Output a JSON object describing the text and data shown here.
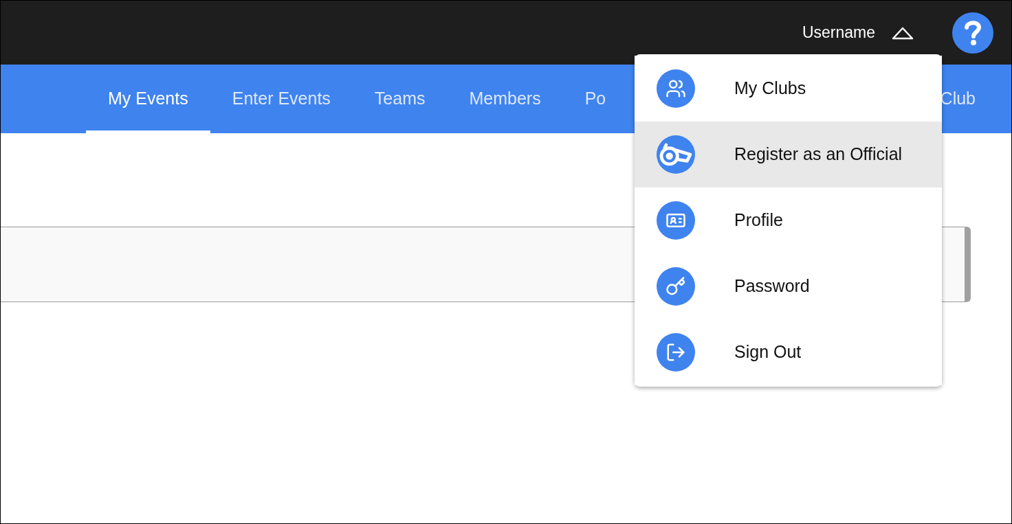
{
  "top_bar": {
    "username": "Username",
    "menu_open": true
  },
  "tabs": [
    {
      "label": "My Events",
      "selected": true
    },
    {
      "label": "Enter Events",
      "selected": false
    },
    {
      "label": "Teams",
      "selected": false
    },
    {
      "label": "Members",
      "selected": false
    },
    {
      "label": "Po",
      "selected": false
    },
    {
      "label": "Club",
      "selected": false
    }
  ],
  "user_menu": [
    {
      "label": "My Clubs",
      "selected": false
    },
    {
      "label": "Register as an Official",
      "selected": true
    },
    {
      "label": "Profile",
      "selected": false
    },
    {
      "label": "Password",
      "selected": false
    },
    {
      "label": "Sign Out",
      "selected": false
    }
  ]
}
